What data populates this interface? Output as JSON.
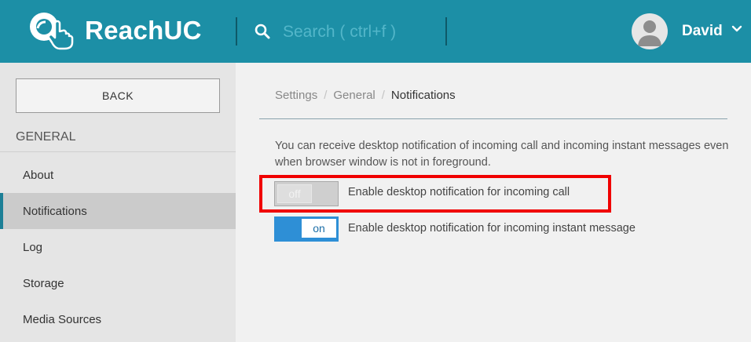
{
  "header": {
    "app_name": "ReachUC",
    "search_placeholder": "Search ( ctrl+f )",
    "user_name": "David"
  },
  "sidebar": {
    "back_label": "BACK",
    "section_title": "GENERAL",
    "items": [
      {
        "label": "About",
        "active": false
      },
      {
        "label": "Notifications",
        "active": true
      },
      {
        "label": "Log",
        "active": false
      },
      {
        "label": "Storage",
        "active": false
      },
      {
        "label": "Media Sources",
        "active": false
      }
    ]
  },
  "breadcrumb": [
    "Settings",
    "General",
    "Notifications"
  ],
  "content": {
    "description": "You can receive desktop notification of incoming call and incoming instant messages even when browser window is not in foreground.",
    "toggles": [
      {
        "state": "off",
        "state_label": "off",
        "label": "Enable desktop notification for incoming call"
      },
      {
        "state": "on",
        "state_label": "on",
        "label": "Enable desktop notification for incoming instant message"
      }
    ]
  },
  "colors": {
    "header_bg": "#1c8fa6",
    "toggle_on": "#2e8fd6",
    "highlight": "#f00000"
  }
}
